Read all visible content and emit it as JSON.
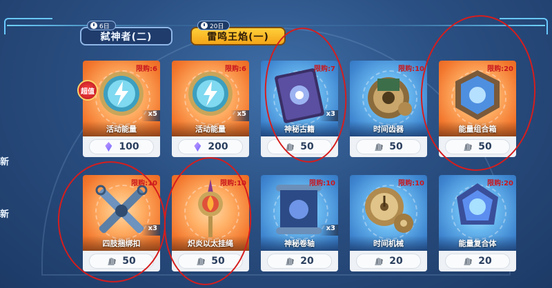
{
  "tabs": [
    {
      "days": "6日",
      "label": "弑神者(二)",
      "active": false
    },
    {
      "days": "20日",
      "label": "雷鸣王焰(一)",
      "active": true
    }
  ],
  "edge_text": [
    "新",
    "新"
  ],
  "items": [
    {
      "name": "活动能量",
      "limit": "限购:6",
      "qty": "x5",
      "price": "100",
      "currency": "crystal-icon",
      "badge": "超值",
      "theme": "orange",
      "art": "energy-orb-icon"
    },
    {
      "name": "活动能量",
      "limit": "限购:6",
      "qty": "x5",
      "price": "200",
      "currency": "crystal-icon",
      "badge": "",
      "theme": "orange",
      "art": "energy-orb-icon"
    },
    {
      "name": "神秘古籍",
      "limit": "限购:7",
      "qty": "x3",
      "price": "50",
      "currency": "shell-icon",
      "badge": "",
      "theme": "blue",
      "art": "ancient-book-icon"
    },
    {
      "name": "时间齿器",
      "limit": "限购:10",
      "qty": "",
      "price": "50",
      "currency": "shell-icon",
      "badge": "",
      "theme": "blue",
      "art": "gear-device-icon"
    },
    {
      "name": "能量组合箱",
      "limit": "限购:20",
      "qty": "",
      "price": "50",
      "currency": "shell-icon",
      "badge": "",
      "theme": "orange",
      "art": "energy-cube-icon"
    },
    {
      "name": "四肢捆绑扣",
      "limit": "限购:10",
      "qty": "x3",
      "price": "50",
      "currency": "shell-icon",
      "badge": "",
      "theme": "orange",
      "art": "binding-cross-icon"
    },
    {
      "name": "炽炎以太挂绳",
      "limit": "限购:10",
      "qty": "",
      "price": "50",
      "currency": "shell-icon",
      "badge": "",
      "theme": "orange",
      "art": "flame-amulet-icon"
    },
    {
      "name": "神秘卷轴",
      "limit": "限购:10",
      "qty": "x3",
      "price": "20",
      "currency": "shell-icon",
      "badge": "",
      "theme": "blue",
      "art": "scroll-icon"
    },
    {
      "name": "时间机械",
      "limit": "限购:10",
      "qty": "",
      "price": "20",
      "currency": "shell-icon",
      "badge": "",
      "theme": "blue",
      "art": "clockwork-icon"
    },
    {
      "name": "能量复合体",
      "limit": "限购:20",
      "qty": "",
      "price": "20",
      "currency": "shell-icon",
      "badge": "",
      "theme": "blue",
      "art": "energy-polyhedron-icon"
    }
  ],
  "colors": {
    "annotation": "#d61d1d",
    "limit_text": "#c8171d",
    "active_tab": "#f4a518"
  }
}
